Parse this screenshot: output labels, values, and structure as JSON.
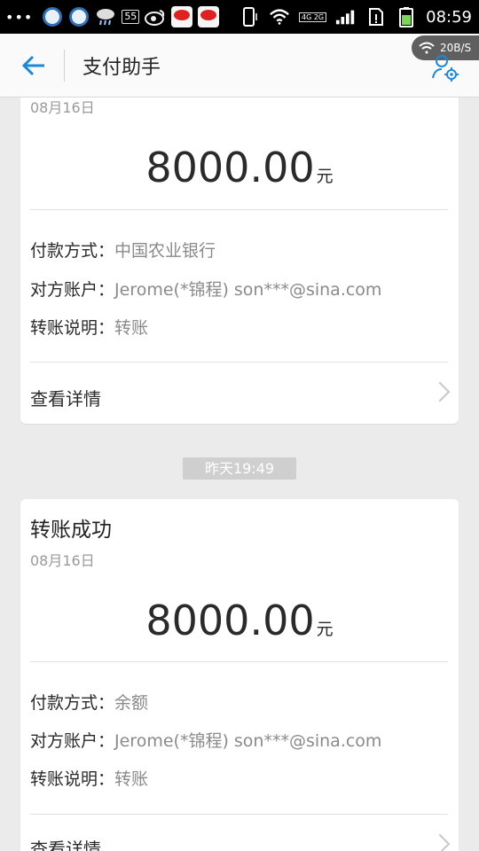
{
  "status_bar": {
    "time": "08:59",
    "notification_badge": "55",
    "network_types": "4G 2G",
    "icons": [
      "overflow-dots-icon",
      "qq-icon",
      "qq-icon",
      "weather-rain-icon",
      "badge-icon",
      "weibo-icon",
      "sina-icon",
      "sina-icon",
      "phone-vibrate-icon",
      "wifi-icon",
      "signal-icon",
      "sim-alert-icon",
      "battery-charging-icon"
    ]
  },
  "app_bar": {
    "title": "支付助手",
    "net_speed": "20B/S"
  },
  "cards": [
    {
      "date": "08月16日",
      "amount": "8000.00",
      "unit": "元",
      "rows": [
        {
          "label": "付款方式：",
          "value": "中国农业银行"
        },
        {
          "label": "对方账户：",
          "value": "Jerome(*锦程) son***@sina.com"
        },
        {
          "label": "转账说明：",
          "value": "转账"
        }
      ],
      "detail_link": "查看详情"
    },
    {
      "title": "转账成功",
      "date": "08月16日",
      "amount": "8000.00",
      "unit": "元",
      "rows": [
        {
          "label": "付款方式：",
          "value": "余额"
        },
        {
          "label": "对方账户：",
          "value": "Jerome(*锦程) son***@sina.com"
        },
        {
          "label": "转账说明：",
          "value": "转账"
        }
      ],
      "detail_link": "查看详情"
    }
  ],
  "time_divider": "昨天19:49",
  "colors": {
    "accent": "#1e88d8",
    "background": "#ebebeb",
    "card": "#ffffff",
    "muted_text": "#8a8a8a"
  }
}
